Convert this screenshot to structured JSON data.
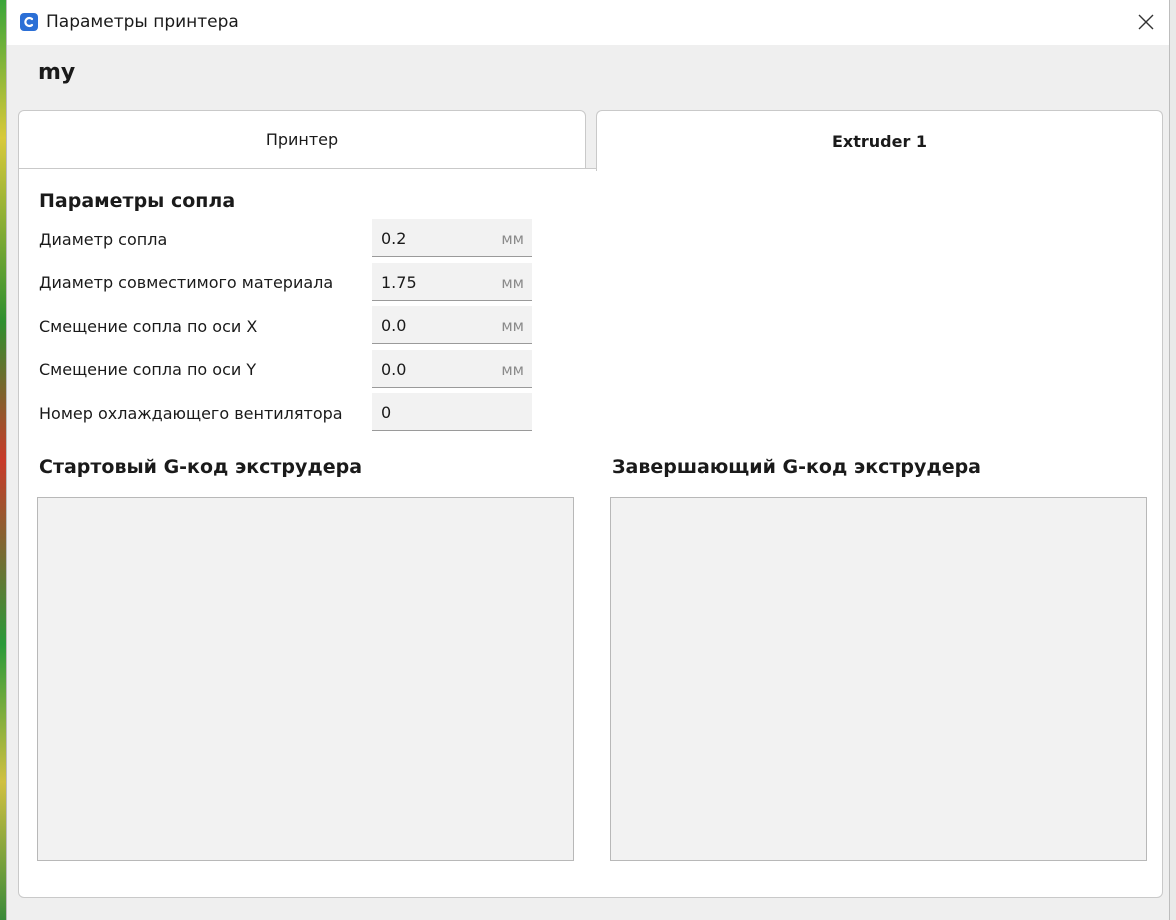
{
  "window": {
    "title": "Параметры принтера",
    "printer_name": "my"
  },
  "tabs": [
    {
      "label": "Принтер",
      "active": false
    },
    {
      "label": "Extruder 1",
      "active": true
    }
  ],
  "nozzle_settings": {
    "title": "Параметры сопла",
    "rows": [
      {
        "label": "Диаметр сопла",
        "value": "0.2",
        "unit": "мм"
      },
      {
        "label": "Диаметр совместимого материала",
        "value": "1.75",
        "unit": "мм"
      },
      {
        "label": "Смещение сопла по оси X",
        "value": "0.0",
        "unit": "мм"
      },
      {
        "label": "Смещение сопла по оси Y",
        "value": "0.0",
        "unit": "мм"
      },
      {
        "label": "Номер охлаждающего вентилятора",
        "value": "0",
        "unit": ""
      }
    ]
  },
  "gcode": {
    "start_title": "Стартовый G-код экструдера",
    "end_title": "Завершающий G-код экструдера",
    "start_value": "",
    "end_value": ""
  },
  "colors": {
    "accent": "#2b6fd6"
  },
  "icons": {
    "app": "cura-app-icon",
    "close": "close-icon"
  }
}
